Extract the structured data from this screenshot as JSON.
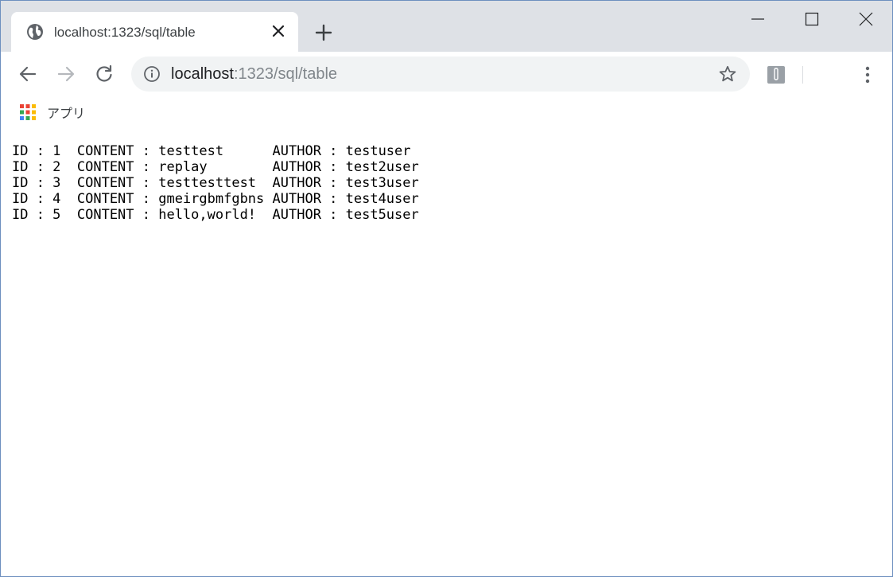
{
  "tab": {
    "title": "localhost:1323/sql/table"
  },
  "address_bar": {
    "host": "localhost",
    "path": ":1323/sql/table"
  },
  "bookmarks": {
    "apps_label": "アプリ"
  },
  "icons": {
    "favicon": "globe-icon",
    "tab_close": "close-icon",
    "new_tab": "plus-icon",
    "back": "arrow-left-icon",
    "forward": "arrow-right-icon",
    "reload": "reload-icon",
    "site_info": "info-icon",
    "bookmark": "star-icon",
    "extension": "extension-icon",
    "menu": "kebab-menu-icon",
    "minimize": "minimize-icon",
    "maximize": "maximize-icon",
    "close_window": "close-icon"
  },
  "colors": {
    "tabstrip_bg": "#dee1e6",
    "omnibox_bg": "#f1f3f4",
    "window_border": "#6d8fbf"
  },
  "rows": [
    "ID : 1  CONTENT : testtest      AUTHOR : testuser",
    "ID : 2  CONTENT : replay        AUTHOR : test2user",
    "ID : 3  CONTENT : testtesttest  AUTHOR : test3user",
    "ID : 4  CONTENT : gmeirgbmfgbns AUTHOR : test4user",
    "ID : 5  CONTENT : hello,world!  AUTHOR : test5user"
  ]
}
